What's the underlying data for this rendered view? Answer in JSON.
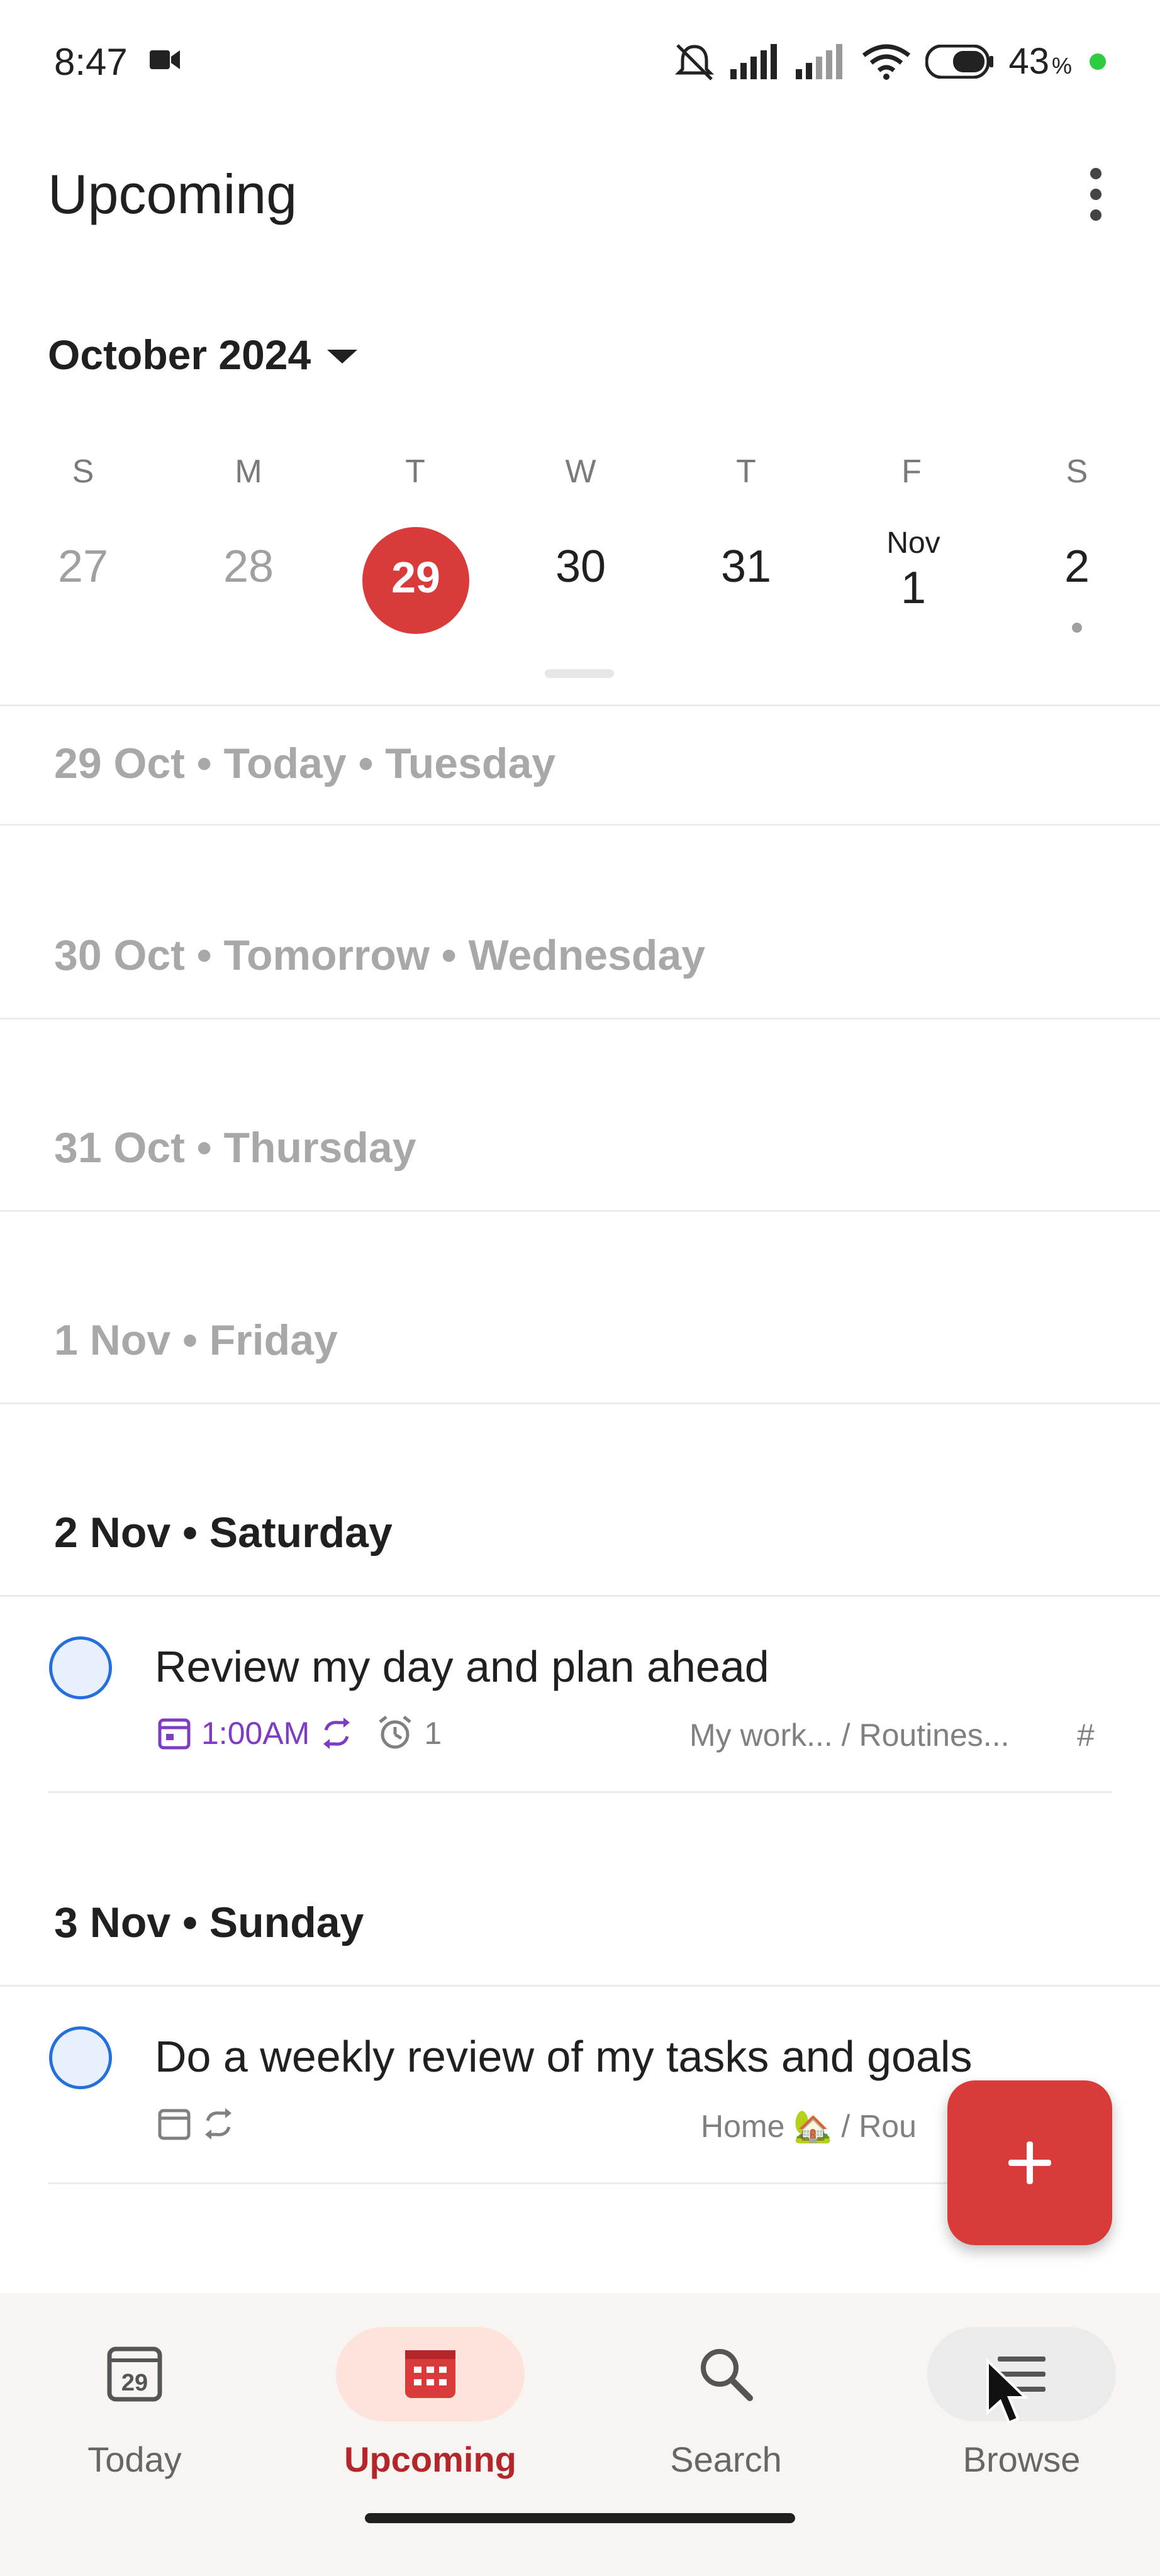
{
  "status_bar": {
    "time": "8:47",
    "battery_level": "43",
    "battery_unit": "%"
  },
  "header": {
    "title": "Upcoming"
  },
  "calendar": {
    "month_label": "October 2024",
    "weekdays": [
      "S",
      "M",
      "T",
      "W",
      "T",
      "F",
      "S"
    ],
    "days": [
      "27",
      "28",
      "29",
      "30",
      "31",
      "1",
      "2"
    ],
    "nov_label": "Nov",
    "today_index": 2
  },
  "sections": [
    {
      "label": "29 Oct • Today • Tuesday"
    },
    {
      "label": "30 Oct • Tomorrow • Wednesday"
    },
    {
      "label": "31 Oct • Thursday"
    },
    {
      "label": "1 Nov • Friday"
    },
    {
      "label": "2 Nov • Saturday"
    },
    {
      "label": "3 Nov • Sunday"
    }
  ],
  "tasks": [
    {
      "title": "Review my day and plan ahead",
      "time": "1:00AM",
      "reminders": "1",
      "project": "My work... / Routines...",
      "hash": "#"
    },
    {
      "title": "Do a weekly review of my tasks and goals",
      "project": "Home 🏡 / Rou"
    }
  ],
  "nav": {
    "items": [
      {
        "label": "Today",
        "icon_day": "29"
      },
      {
        "label": "Upcoming"
      },
      {
        "label": "Search"
      },
      {
        "label": "Browse"
      }
    ]
  },
  "colors": {
    "accent_red": "#d93a3a",
    "active_label": "#b3262a",
    "check_blue": "#246fe0",
    "time_purple": "#7e3cc5"
  }
}
